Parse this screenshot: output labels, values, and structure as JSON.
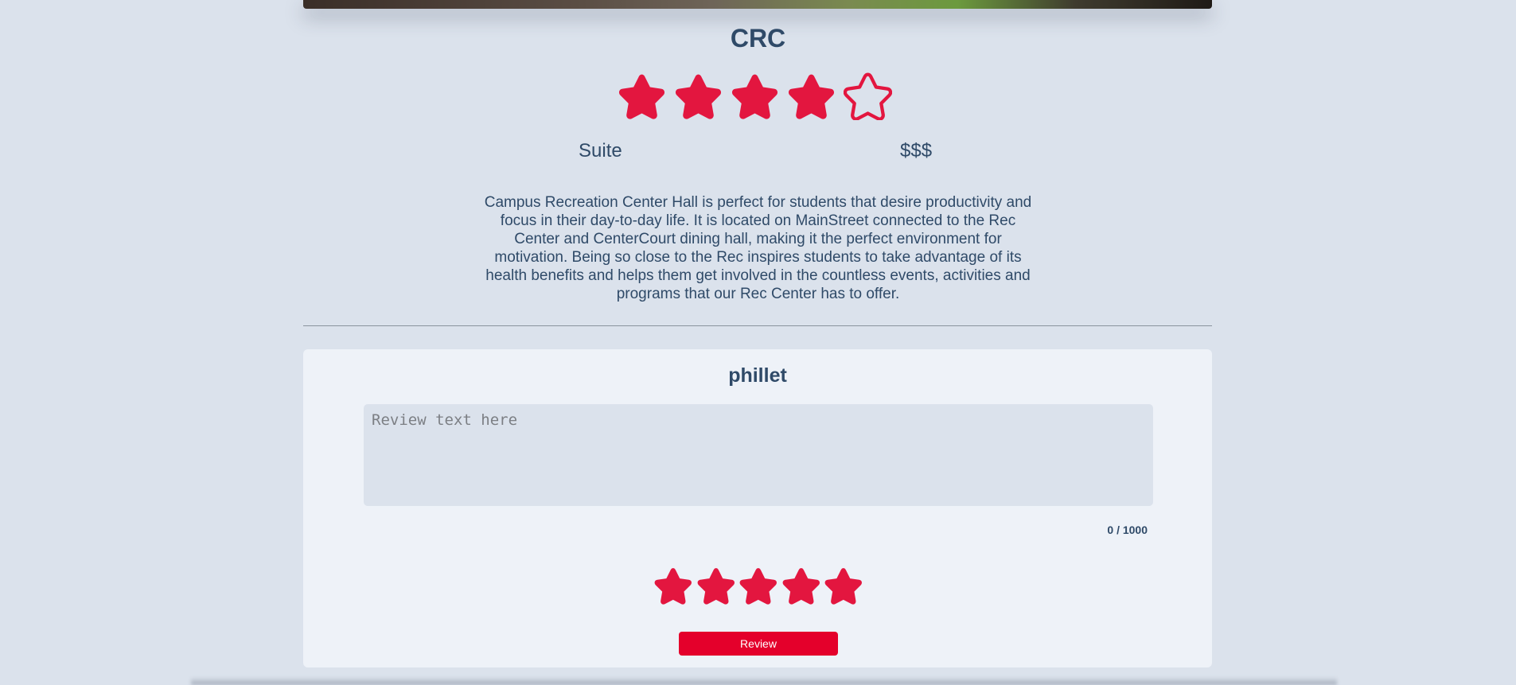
{
  "hall": {
    "name": "CRC",
    "rating": 4,
    "rating_max": 5,
    "room_type": "Suite",
    "price": "$$$",
    "description": "Campus Recreation Center Hall is perfect for students that desire productivity and focus in their day-to-day life. It is located on MainStreet connected to the Rec Center and CenterCourt dining hall, making it the perfect environment for motivation. Being so close to the Rec inspires students to take advantage of its health benefits and helps them get involved in the countless events, activities and programs that our Rec Center has to offer."
  },
  "review_form": {
    "username": "phillet",
    "placeholder": "Review text here",
    "value": "",
    "char_count": "0 / 1000",
    "stars_selected": 5,
    "stars_max": 5,
    "submit_label": "Review"
  },
  "colors": {
    "star": "#e3163f",
    "background": "#dbe2ec",
    "card": "#eef2f8",
    "text": "#2f4a68",
    "button": "#e4002b"
  },
  "icons": {
    "star_filled": "star-icon",
    "star_outline": "star-outline-icon"
  }
}
